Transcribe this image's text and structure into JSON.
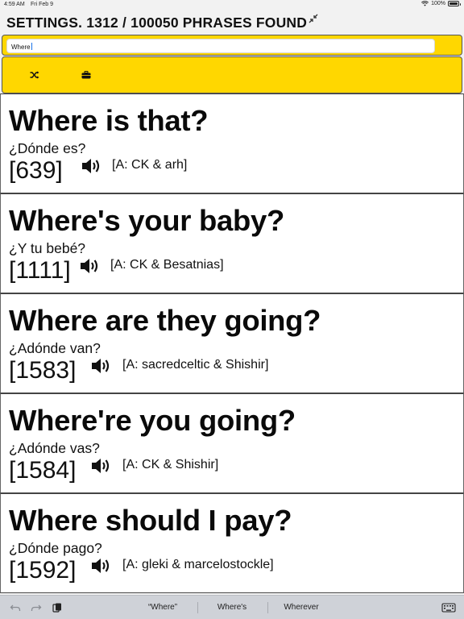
{
  "status_bar": {
    "time": "4:59 AM",
    "date": "Fri Feb 9",
    "battery": "100%"
  },
  "header": {
    "title": "SETTINGS. 1312 / 100050 PHRASES FOUND"
  },
  "search": {
    "value": "Where"
  },
  "colors": {
    "accent": "#ffd700",
    "card_bg": "#ffffff",
    "text": "#111111"
  },
  "toolbar": {
    "icons": [
      "shuffle-icon",
      "briefcase-icon"
    ]
  },
  "phrases": [
    {
      "text": "Where is that?",
      "translation": "¿Dónde es?",
      "number": "[639]",
      "attribution": "[A: CK & arh]"
    },
    {
      "text": "Where's your baby?",
      "translation": "¿Y tu bebé?",
      "number": "[1111]",
      "attribution": "[A: CK & Besatnias]"
    },
    {
      "text": "Where are they going?",
      "translation": "¿Adónde van?",
      "number": "[1583]",
      "attribution": "[A: sacredceltic & Shishir]"
    },
    {
      "text": "Where're you going?",
      "translation": "¿Adónde vas?",
      "number": "[1584]",
      "attribution": "[A: CK & Shishir]"
    },
    {
      "text": "Where should I pay?",
      "translation": "¿Dónde pago?",
      "number": "[1592]",
      "attribution": "[A: gleki & marcelostockle]"
    }
  ],
  "keyboard_bar": {
    "suggestions": [
      "“Where”",
      "Where's",
      "Wherever"
    ]
  }
}
